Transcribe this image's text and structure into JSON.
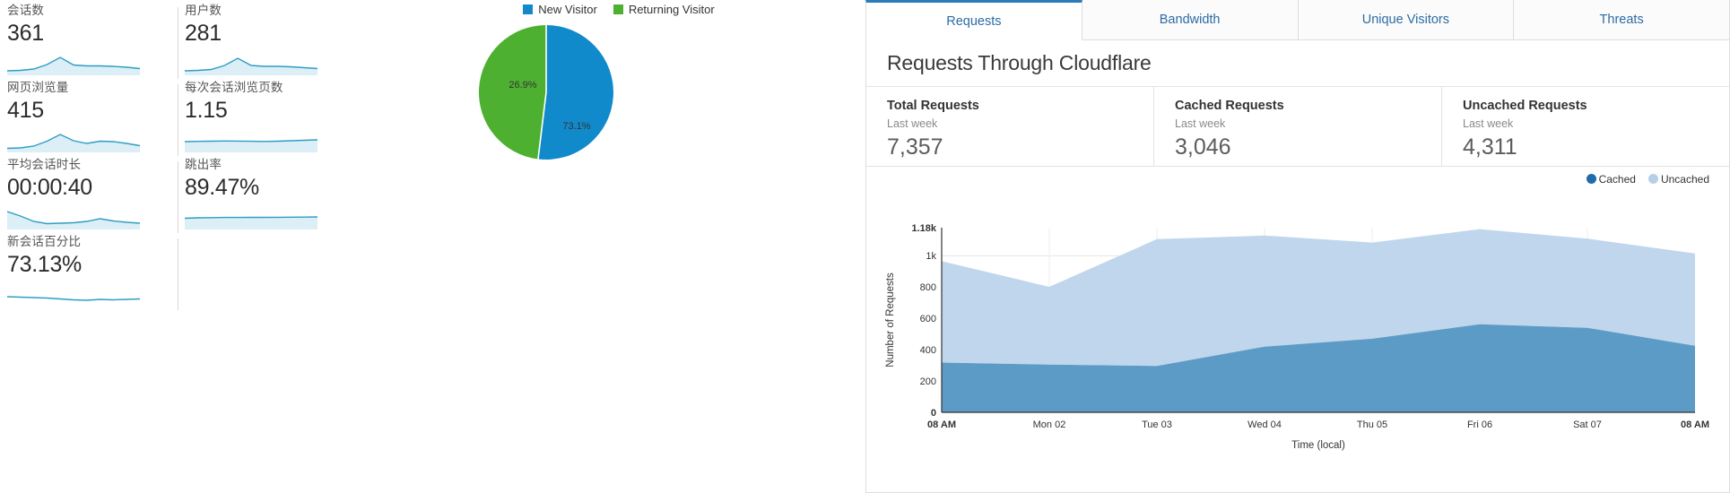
{
  "analytics": {
    "metrics": [
      {
        "label": "会话数",
        "value": "361",
        "spark": [
          30,
          30,
          28,
          22,
          10,
          20,
          21,
          22,
          22,
          24,
          26
        ],
        "fill": true
      },
      {
        "label": "用户数",
        "value": "281",
        "spark": [
          30,
          29,
          27,
          20,
          11,
          21,
          22,
          22,
          23,
          24,
          25
        ],
        "fill": true
      },
      {
        "label": "网页浏览量",
        "value": "415",
        "spark": [
          30,
          29,
          26,
          20,
          9,
          19,
          22,
          19,
          19,
          21,
          24
        ],
        "fill": true
      },
      {
        "label": "每次会话浏览页数",
        "value": "1.15",
        "spark": [
          10,
          10,
          10,
          10,
          9,
          9,
          8,
          8,
          7,
          7,
          6
        ],
        "fill": true
      },
      {
        "label": "平均会话时长",
        "value": "00:00:40",
        "spark": [
          4,
          10,
          20,
          22,
          22,
          21,
          18,
          14,
          17,
          20,
          21
        ],
        "fill": true
      },
      {
        "label": "跳出率",
        "value": "89.47%",
        "spark": [
          9,
          8,
          8,
          8,
          7,
          7,
          7,
          7,
          6,
          6,
          6
        ],
        "fill": true
      },
      {
        "label": "新会话百分比",
        "value": "73.13%",
        "spark": [
          24,
          22,
          20,
          18,
          14,
          11,
          10,
          12,
          11,
          12,
          13
        ],
        "fill": false
      }
    ],
    "spark_color": "#2e9ec4",
    "spark_fill": "#dceef6"
  },
  "visitor_pie": {
    "legend": [
      {
        "label": "New Visitor",
        "color": "#118acb"
      },
      {
        "label": "Returning Visitor",
        "color": "#4eb031"
      }
    ],
    "chart_data": {
      "type": "pie",
      "title": "",
      "labels": [
        "New Visitor",
        "Returning Visitor"
      ],
      "values": [
        73.1,
        26.9
      ],
      "value_labels": [
        "73.1%",
        "26.9%"
      ],
      "colors": [
        "#118acb",
        "#4eb031"
      ],
      "legend_position": "top"
    }
  },
  "cloudflare": {
    "tabs": [
      {
        "label": "Requests",
        "active": true
      },
      {
        "label": "Bandwidth",
        "active": false
      },
      {
        "label": "Unique Visitors",
        "active": false
      },
      {
        "label": "Threats",
        "active": false
      }
    ],
    "title": "Requests Through Cloudflare",
    "stats": [
      {
        "title": "Total Requests",
        "period": "Last week",
        "value": "7,357"
      },
      {
        "title": "Cached Requests",
        "period": "Last week",
        "value": "3,046"
      },
      {
        "title": "Uncached Requests",
        "period": "Last week",
        "value": "4,311"
      }
    ],
    "legend": [
      {
        "label": "Cached",
        "color": "#1f6bab"
      },
      {
        "label": "Uncached",
        "color": "#b6cfe8"
      }
    ],
    "chart_data": {
      "type": "area",
      "stacked": true,
      "title": "Requests Through Cloudflare",
      "xlabel": "Time (local)",
      "ylabel": "Number of Requests",
      "ylim": [
        0,
        1180
      ],
      "yticks": [
        0,
        200,
        400,
        600,
        800,
        1000,
        1180
      ],
      "ytick_labels": [
        "0",
        "200",
        "400",
        "600",
        "800",
        "1k",
        "1.18k"
      ],
      "grid": true,
      "x": [
        "08 AM",
        "Mon 02",
        "Tue 03",
        "Wed 04",
        "Thu 05",
        "Fri 06",
        "Sat 07",
        "08 AM"
      ],
      "xtick_labels": [
        "08 AM",
        "Mon 02",
        "Tue 03",
        "Wed 04",
        "Thu 05",
        "Fri 06",
        "Sat 07",
        "08 AM"
      ],
      "series": [
        {
          "name": "Cached",
          "color": "#5d9bc7",
          "values": [
            318,
            305,
            297,
            420,
            470,
            563,
            540,
            425
          ]
        },
        {
          "name": "Uncached",
          "color": "#c0d6ec",
          "values": [
            648,
            497,
            810,
            710,
            615,
            608,
            570,
            590
          ]
        }
      ],
      "series_totals": [
        966,
        802,
        1107,
        1130,
        1085,
        1171,
        1110,
        1015
      ]
    }
  }
}
